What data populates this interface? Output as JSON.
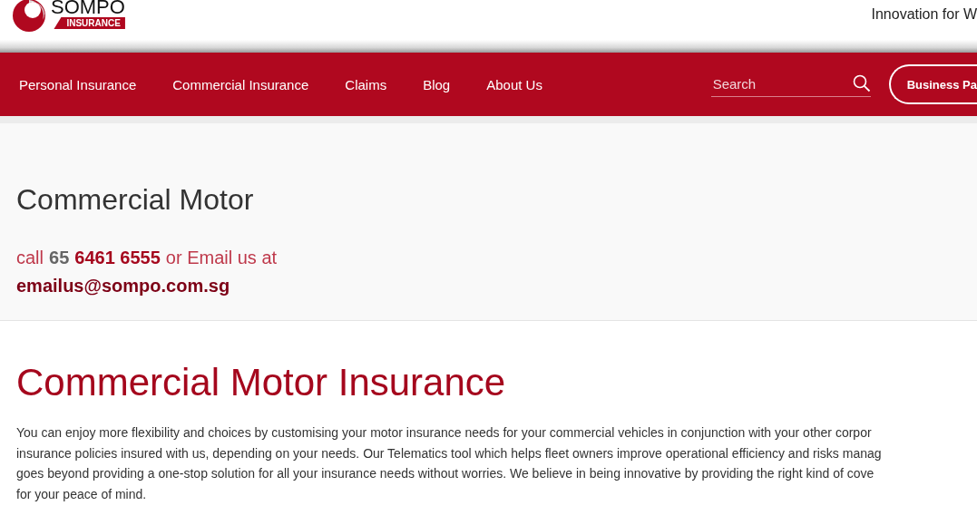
{
  "header": {
    "logo_name": "SOMPO",
    "logo_sub": "INSURANCE",
    "tagline": "Innovation for W"
  },
  "nav": {
    "items": [
      {
        "label": "Personal Insurance"
      },
      {
        "label": "Commercial Insurance"
      },
      {
        "label": "Claims"
      },
      {
        "label": "Blog"
      },
      {
        "label": "About Us"
      }
    ],
    "search": {
      "placeholder": "Search"
    },
    "button": "Business Pa"
  },
  "banner": {
    "title": "Commercial Motor",
    "call_prefix": "call",
    "country_code": "65",
    "phone": "6461 6555",
    "email_prefix": "or Email us at",
    "email": "emailus@sompo.com.sg"
  },
  "content": {
    "heading": "Commercial Motor Insurance",
    "lines": [
      "You can enjoy more flexibility and choices by customising your motor insurance needs for your commercial vehicles in conjunction with your other corpor",
      "insurance policies insured with us, depending on your needs. Our Telematics tool which helps fleet owners improve operational efficiency and risks manag",
      "goes beyond providing a one-stop solution for all your insurance needs without worries. We believe in being innovative by providing the right kind of cove",
      "for your peace of mind."
    ]
  }
}
